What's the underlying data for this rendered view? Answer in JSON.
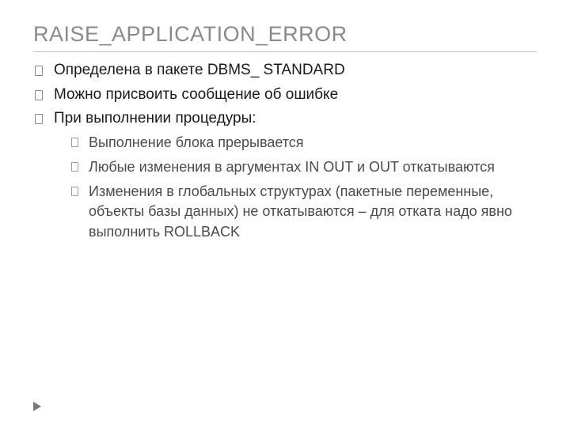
{
  "title": "RAISE_APPLICATION_ERROR",
  "bullets": {
    "b1": "Определена в пакете DBMS_ STANDARD",
    "b2": "Можно присвоить сообщение об ошибке",
    "b3": "При выполнении процедуры:",
    "sub1": "Выполнение блока прерывается",
    "sub2": "Любые изменения в аргументах IN OUT и OUT откатываются",
    "sub3": "Изменения в глобальных структурах (пакетные переменные, объекты базы данных) не откатываются – для отката надо явно выполнить ROLLBACK"
  }
}
